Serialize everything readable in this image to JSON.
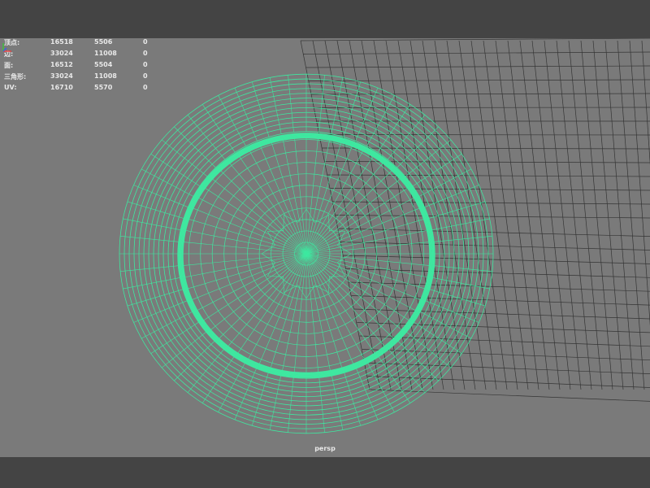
{
  "hud": {
    "rows": [
      {
        "label": "顶点:",
        "v1": "16518",
        "v2": "5506",
        "v3": "0"
      },
      {
        "label": "边:",
        "v1": "33024",
        "v2": "11008",
        "v3": "0"
      },
      {
        "label": "面:",
        "v1": "16512",
        "v2": "5504",
        "v3": "0"
      },
      {
        "label": "三角形:",
        "v1": "33024",
        "v2": "11008",
        "v3": "0"
      },
      {
        "label": "UV:",
        "v1": "16710",
        "v2": "5570",
        "v3": "0"
      }
    ]
  },
  "viewport": {
    "camera": "persp",
    "wire_color": "#3ee8a0",
    "grid_color": "#2e2e2e",
    "bg_color": "#7a7a7a"
  }
}
